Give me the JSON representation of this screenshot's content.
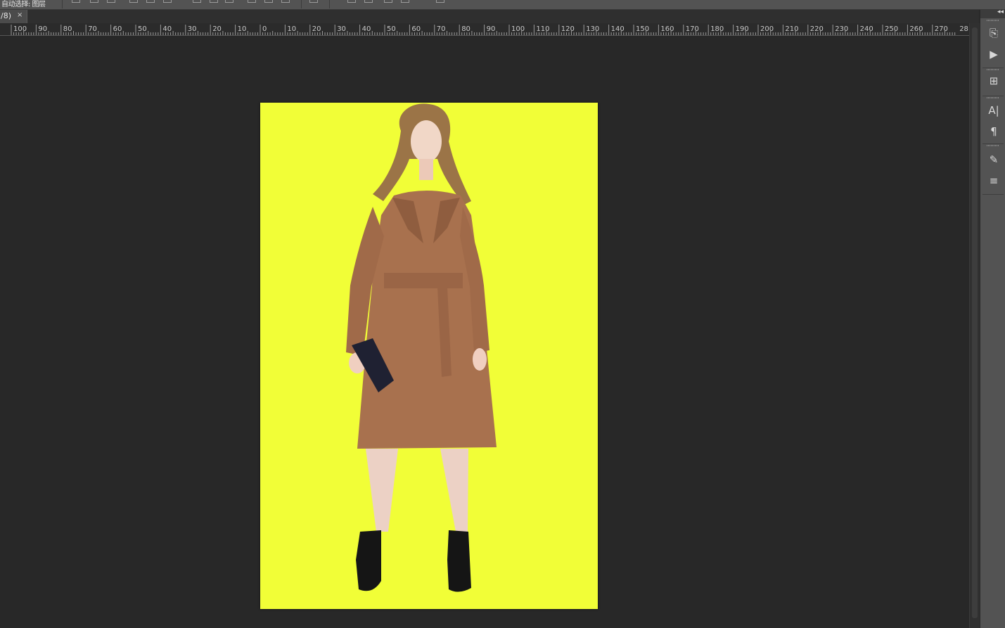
{
  "options_bar": {
    "label": "自动选择: 图层",
    "icons": [
      "align-top-icon",
      "align-vcenter-icon",
      "align-bottom-icon",
      "align-left-icon",
      "align-hcenter-icon",
      "align-right-icon",
      "distribute-top-icon",
      "distribute-vcenter-icon",
      "distribute-bottom-icon",
      "distribute-left-icon",
      "distribute-hcenter-icon",
      "distribute-right-icon",
      "auto-align-icon",
      "3d-rotate-icon",
      "3d-roll-icon",
      "3d-pan-icon",
      "3d-slide-icon",
      "3d-scale-icon"
    ]
  },
  "tab": {
    "title": "/8)",
    "close": "×"
  },
  "ruler": {
    "labels": [
      "100",
      "90",
      "80",
      "70",
      "60",
      "50",
      "40",
      "30",
      "20",
      "10",
      "0",
      "10",
      "20",
      "30",
      "40",
      "50",
      "60",
      "70",
      "80",
      "90",
      "100",
      "110",
      "120",
      "130",
      "140",
      "150",
      "160",
      "170",
      "180",
      "190",
      "200",
      "210",
      "220",
      "230",
      "240",
      "250",
      "260",
      "270",
      "28"
    ]
  },
  "canvas": {
    "background_color": "#f1fe37",
    "subject": "model-in-camel-coat"
  },
  "dock": {
    "collapse": "◂◂",
    "buttons": [
      {
        "name": "history-panel-icon",
        "glyph": "⎘"
      },
      {
        "name": "actions-panel-icon",
        "glyph": "▶"
      },
      {
        "name": "properties-panel-icon",
        "glyph": "⊞"
      },
      {
        "name": "character-panel-icon",
        "glyph": "A|"
      },
      {
        "name": "paragraph-panel-icon",
        "glyph": "¶"
      },
      {
        "name": "brush-presets-panel-icon",
        "glyph": "✎"
      },
      {
        "name": "brush-settings-panel-icon",
        "glyph": "≡"
      }
    ]
  }
}
